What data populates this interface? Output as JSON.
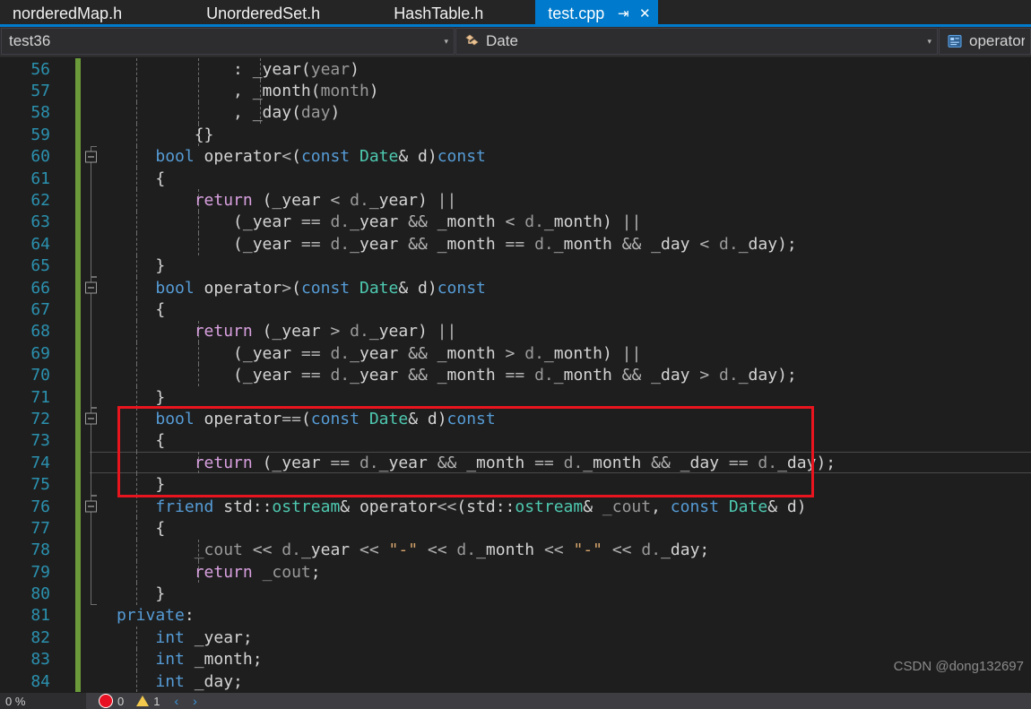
{
  "tabs": [
    {
      "label": "norderedMap.h",
      "active": false
    },
    {
      "label": "UnorderedSet.h",
      "active": false
    },
    {
      "label": "HashTable.h",
      "active": false
    },
    {
      "label": "test.cpp",
      "active": true,
      "pin": "⇥",
      "close": "✕"
    }
  ],
  "navbar": {
    "project": "test36",
    "class": "Date",
    "member": "operator==",
    "arrow": "▾",
    "project_icon": "project-icon",
    "class_icon": "class-icon",
    "member_icon": "method-icon"
  },
  "editor": {
    "lines": [
      {
        "num": "56",
        "indent_guides": [
          0,
          1,
          2
        ],
        "tokens": [
          {
            "t": "            : ",
            "c": "pln"
          },
          {
            "t": "_year",
            "c": "pln"
          },
          {
            "t": "(",
            "c": "pln"
          },
          {
            "t": "year",
            "c": "prm"
          },
          {
            "t": ")",
            "c": "pln"
          }
        ]
      },
      {
        "num": "57",
        "indent_guides": [
          0,
          1,
          2
        ],
        "tokens": [
          {
            "t": "            , ",
            "c": "pln"
          },
          {
            "t": "_month",
            "c": "pln"
          },
          {
            "t": "(",
            "c": "pln"
          },
          {
            "t": "month",
            "c": "prm"
          },
          {
            "t": ")",
            "c": "pln"
          }
        ]
      },
      {
        "num": "58",
        "indent_guides": [
          0,
          1,
          2
        ],
        "tokens": [
          {
            "t": "            , ",
            "c": "pln"
          },
          {
            "t": "_day",
            "c": "pln"
          },
          {
            "t": "(",
            "c": "pln"
          },
          {
            "t": "day",
            "c": "prm"
          },
          {
            "t": ")",
            "c": "pln"
          }
        ]
      },
      {
        "num": "59",
        "indent_guides": [
          0,
          1
        ],
        "tokens": [
          {
            "t": "        {}",
            "c": "pln"
          }
        ]
      },
      {
        "num": "60",
        "indent_guides": [
          0
        ],
        "collapse": true,
        "vline": "top",
        "tokens": [
          {
            "t": "    ",
            "c": "pln"
          },
          {
            "t": "bool",
            "c": "kw"
          },
          {
            "t": " operator",
            "c": "pln"
          },
          {
            "t": "<",
            "c": "op"
          },
          {
            "t": "(",
            "c": "pln"
          },
          {
            "t": "const",
            "c": "kw"
          },
          {
            "t": " ",
            "c": "pln"
          },
          {
            "t": "Date",
            "c": "type"
          },
          {
            "t": "& d)",
            "c": "pln"
          },
          {
            "t": "const",
            "c": "kw"
          }
        ]
      },
      {
        "num": "61",
        "indent_guides": [
          0
        ],
        "vline": "mid",
        "tokens": [
          {
            "t": "    {",
            "c": "pln"
          }
        ]
      },
      {
        "num": "62",
        "indent_guides": [
          0,
          1
        ],
        "vline": "mid",
        "tokens": [
          {
            "t": "        ",
            "c": "pln"
          },
          {
            "t": "return",
            "c": "ctrl"
          },
          {
            "t": " (_year ",
            "c": "pln"
          },
          {
            "t": "<",
            "c": "op"
          },
          {
            "t": " ",
            "c": "pln"
          },
          {
            "t": "d.",
            "c": "prm"
          },
          {
            "t": "_year) ",
            "c": "pln"
          },
          {
            "t": "||",
            "c": "op"
          }
        ]
      },
      {
        "num": "63",
        "indent_guides": [
          0,
          1
        ],
        "vline": "mid",
        "tokens": [
          {
            "t": "            (_year ",
            "c": "pln"
          },
          {
            "t": "==",
            "c": "op"
          },
          {
            "t": " ",
            "c": "pln"
          },
          {
            "t": "d.",
            "c": "prm"
          },
          {
            "t": "_year ",
            "c": "pln"
          },
          {
            "t": "&&",
            "c": "op"
          },
          {
            "t": " _month ",
            "c": "pln"
          },
          {
            "t": "<",
            "c": "op"
          },
          {
            "t": " ",
            "c": "pln"
          },
          {
            "t": "d.",
            "c": "prm"
          },
          {
            "t": "_month) ",
            "c": "pln"
          },
          {
            "t": "||",
            "c": "op"
          }
        ]
      },
      {
        "num": "64",
        "indent_guides": [
          0,
          1
        ],
        "vline": "mid",
        "tokens": [
          {
            "t": "            (_year ",
            "c": "pln"
          },
          {
            "t": "==",
            "c": "op"
          },
          {
            "t": " ",
            "c": "pln"
          },
          {
            "t": "d.",
            "c": "prm"
          },
          {
            "t": "_year ",
            "c": "pln"
          },
          {
            "t": "&&",
            "c": "op"
          },
          {
            "t": " _month ",
            "c": "pln"
          },
          {
            "t": "==",
            "c": "op"
          },
          {
            "t": " ",
            "c": "pln"
          },
          {
            "t": "d.",
            "c": "prm"
          },
          {
            "t": "_month ",
            "c": "pln"
          },
          {
            "t": "&&",
            "c": "op"
          },
          {
            "t": " _day ",
            "c": "pln"
          },
          {
            "t": "<",
            "c": "op"
          },
          {
            "t": " ",
            "c": "pln"
          },
          {
            "t": "d.",
            "c": "prm"
          },
          {
            "t": "_day);",
            "c": "pln"
          }
        ]
      },
      {
        "num": "65",
        "indent_guides": [
          0
        ],
        "vline": "bottom",
        "tokens": [
          {
            "t": "    }",
            "c": "pln"
          }
        ]
      },
      {
        "num": "66",
        "indent_guides": [
          0
        ],
        "collapse": true,
        "vline": "top",
        "tokens": [
          {
            "t": "    ",
            "c": "pln"
          },
          {
            "t": "bool",
            "c": "kw"
          },
          {
            "t": " operator",
            "c": "pln"
          },
          {
            "t": ">",
            "c": "op"
          },
          {
            "t": "(",
            "c": "pln"
          },
          {
            "t": "const",
            "c": "kw"
          },
          {
            "t": " ",
            "c": "pln"
          },
          {
            "t": "Date",
            "c": "type"
          },
          {
            "t": "& d)",
            "c": "pln"
          },
          {
            "t": "const",
            "c": "kw"
          }
        ]
      },
      {
        "num": "67",
        "indent_guides": [
          0
        ],
        "vline": "mid",
        "tokens": [
          {
            "t": "    {",
            "c": "pln"
          }
        ]
      },
      {
        "num": "68",
        "indent_guides": [
          0,
          1
        ],
        "vline": "mid",
        "tokens": [
          {
            "t": "        ",
            "c": "pln"
          },
          {
            "t": "return",
            "c": "ctrl"
          },
          {
            "t": " (_year ",
            "c": "pln"
          },
          {
            "t": ">",
            "c": "op"
          },
          {
            "t": " ",
            "c": "pln"
          },
          {
            "t": "d.",
            "c": "prm"
          },
          {
            "t": "_year) ",
            "c": "pln"
          },
          {
            "t": "||",
            "c": "op"
          }
        ]
      },
      {
        "num": "69",
        "indent_guides": [
          0,
          1
        ],
        "vline": "mid",
        "tokens": [
          {
            "t": "            (_year ",
            "c": "pln"
          },
          {
            "t": "==",
            "c": "op"
          },
          {
            "t": " ",
            "c": "pln"
          },
          {
            "t": "d.",
            "c": "prm"
          },
          {
            "t": "_year ",
            "c": "pln"
          },
          {
            "t": "&&",
            "c": "op"
          },
          {
            "t": " _month ",
            "c": "pln"
          },
          {
            "t": ">",
            "c": "op"
          },
          {
            "t": " ",
            "c": "pln"
          },
          {
            "t": "d.",
            "c": "prm"
          },
          {
            "t": "_month) ",
            "c": "pln"
          },
          {
            "t": "||",
            "c": "op"
          }
        ]
      },
      {
        "num": "70",
        "indent_guides": [
          0,
          1
        ],
        "vline": "mid",
        "tokens": [
          {
            "t": "            (_year ",
            "c": "pln"
          },
          {
            "t": "==",
            "c": "op"
          },
          {
            "t": " ",
            "c": "pln"
          },
          {
            "t": "d.",
            "c": "prm"
          },
          {
            "t": "_year ",
            "c": "pln"
          },
          {
            "t": "&&",
            "c": "op"
          },
          {
            "t": " _month ",
            "c": "pln"
          },
          {
            "t": "==",
            "c": "op"
          },
          {
            "t": " ",
            "c": "pln"
          },
          {
            "t": "d.",
            "c": "prm"
          },
          {
            "t": "_month ",
            "c": "pln"
          },
          {
            "t": "&&",
            "c": "op"
          },
          {
            "t": " _day ",
            "c": "pln"
          },
          {
            "t": ">",
            "c": "op"
          },
          {
            "t": " ",
            "c": "pln"
          },
          {
            "t": "d.",
            "c": "prm"
          },
          {
            "t": "_day);",
            "c": "pln"
          }
        ]
      },
      {
        "num": "71",
        "indent_guides": [
          0
        ],
        "vline": "bottom",
        "tokens": [
          {
            "t": "    }",
            "c": "pln"
          }
        ]
      },
      {
        "num": "72",
        "indent_guides": [
          0
        ],
        "collapse": true,
        "vline": "top",
        "tokens": [
          {
            "t": "    ",
            "c": "pln"
          },
          {
            "t": "bool",
            "c": "kw"
          },
          {
            "t": " operator",
            "c": "pln"
          },
          {
            "t": "==",
            "c": "op"
          },
          {
            "t": "(",
            "c": "pln"
          },
          {
            "t": "const",
            "c": "kw"
          },
          {
            "t": " ",
            "c": "pln"
          },
          {
            "t": "Date",
            "c": "type"
          },
          {
            "t": "& d)",
            "c": "pln"
          },
          {
            "t": "const",
            "c": "kw"
          }
        ]
      },
      {
        "num": "73",
        "indent_guides": [
          0
        ],
        "vline": "mid",
        "tokens": [
          {
            "t": "    {",
            "c": "pln"
          }
        ]
      },
      {
        "num": "74",
        "indent_guides": [
          0,
          1
        ],
        "vline": "mid",
        "current": true,
        "tokens": [
          {
            "t": "        ",
            "c": "pln"
          },
          {
            "t": "return",
            "c": "ctrl"
          },
          {
            "t": " (_year ",
            "c": "pln"
          },
          {
            "t": "==",
            "c": "op"
          },
          {
            "t": " ",
            "c": "pln"
          },
          {
            "t": "d.",
            "c": "prm"
          },
          {
            "t": "_year ",
            "c": "pln"
          },
          {
            "t": "&&",
            "c": "op"
          },
          {
            "t": " _month ",
            "c": "pln"
          },
          {
            "t": "==",
            "c": "op"
          },
          {
            "t": " ",
            "c": "pln"
          },
          {
            "t": "d.",
            "c": "prm"
          },
          {
            "t": "_month ",
            "c": "pln"
          },
          {
            "t": "&&",
            "c": "op"
          },
          {
            "t": " _day ",
            "c": "pln"
          },
          {
            "t": "==",
            "c": "op"
          },
          {
            "t": " ",
            "c": "pln"
          },
          {
            "t": "d.",
            "c": "prm"
          },
          {
            "t": "_day);",
            "c": "pln"
          }
        ]
      },
      {
        "num": "75",
        "indent_guides": [
          0
        ],
        "vline": "bottom",
        "tokens": [
          {
            "t": "    }",
            "c": "pln"
          }
        ]
      },
      {
        "num": "76",
        "indent_guides": [
          0
        ],
        "collapse": true,
        "vline": "top",
        "tokens": [
          {
            "t": "    ",
            "c": "pln"
          },
          {
            "t": "friend",
            "c": "kw"
          },
          {
            "t": " std::",
            "c": "pln"
          },
          {
            "t": "ostream",
            "c": "type"
          },
          {
            "t": "& operator",
            "c": "pln"
          },
          {
            "t": "<<",
            "c": "op"
          },
          {
            "t": "(std::",
            "c": "pln"
          },
          {
            "t": "ostream",
            "c": "type"
          },
          {
            "t": "& ",
            "c": "pln"
          },
          {
            "t": "_cout",
            "c": "prm"
          },
          {
            "t": ", ",
            "c": "pln"
          },
          {
            "t": "const",
            "c": "kw"
          },
          {
            "t": " ",
            "c": "pln"
          },
          {
            "t": "Date",
            "c": "type"
          },
          {
            "t": "& d)",
            "c": "pln"
          }
        ]
      },
      {
        "num": "77",
        "indent_guides": [
          0
        ],
        "vline": "mid",
        "tokens": [
          {
            "t": "    {",
            "c": "pln"
          }
        ]
      },
      {
        "num": "78",
        "indent_guides": [
          0,
          1
        ],
        "vline": "mid",
        "tokens": [
          {
            "t": "        ",
            "c": "pln"
          },
          {
            "t": "_cout",
            "c": "prm"
          },
          {
            "t": " ",
            "c": "pln"
          },
          {
            "t": "<<",
            "c": "op"
          },
          {
            "t": " ",
            "c": "pln"
          },
          {
            "t": "d.",
            "c": "prm"
          },
          {
            "t": "_year ",
            "c": "pln"
          },
          {
            "t": "<<",
            "c": "op"
          },
          {
            "t": " ",
            "c": "pln"
          },
          {
            "t": "\"-\"",
            "c": "str"
          },
          {
            "t": " ",
            "c": "pln"
          },
          {
            "t": "<<",
            "c": "op"
          },
          {
            "t": " ",
            "c": "pln"
          },
          {
            "t": "d.",
            "c": "prm"
          },
          {
            "t": "_month ",
            "c": "pln"
          },
          {
            "t": "<<",
            "c": "op"
          },
          {
            "t": " ",
            "c": "pln"
          },
          {
            "t": "\"-\"",
            "c": "str"
          },
          {
            "t": " ",
            "c": "pln"
          },
          {
            "t": "<<",
            "c": "op"
          },
          {
            "t": " ",
            "c": "pln"
          },
          {
            "t": "d.",
            "c": "prm"
          },
          {
            "t": "_day;",
            "c": "pln"
          }
        ]
      },
      {
        "num": "79",
        "indent_guides": [
          0,
          1
        ],
        "vline": "mid",
        "tokens": [
          {
            "t": "        ",
            "c": "pln"
          },
          {
            "t": "return",
            "c": "ctrl"
          },
          {
            "t": " ",
            "c": "pln"
          },
          {
            "t": "_cout",
            "c": "prm"
          },
          {
            "t": ";",
            "c": "pln"
          }
        ]
      },
      {
        "num": "80",
        "indent_guides": [
          0
        ],
        "vline": "bottom",
        "tokens": [
          {
            "t": "    }",
            "c": "pln"
          }
        ]
      },
      {
        "num": "81",
        "indent_guides": [],
        "tokens": [
          {
            "t": "",
            "c": "pln"
          },
          {
            "t": "private",
            "c": "kw"
          },
          {
            "t": ":",
            "c": "pln"
          }
        ]
      },
      {
        "num": "82",
        "indent_guides": [
          0
        ],
        "tokens": [
          {
            "t": "    ",
            "c": "pln"
          },
          {
            "t": "int",
            "c": "kw"
          },
          {
            "t": " _year;",
            "c": "pln"
          }
        ]
      },
      {
        "num": "83",
        "indent_guides": [
          0
        ],
        "tokens": [
          {
            "t": "    ",
            "c": "pln"
          },
          {
            "t": "int",
            "c": "kw"
          },
          {
            "t": " _month;",
            "c": "pln"
          }
        ]
      },
      {
        "num": "84",
        "indent_guides": [
          0
        ],
        "tokens": [
          {
            "t": "    ",
            "c": "pln"
          },
          {
            "t": "int",
            "c": "kw"
          },
          {
            "t": " _day;",
            "c": "pln"
          }
        ]
      }
    ],
    "annotation": {
      "color": "#e8141e"
    }
  },
  "watermark": "CSDN @dong132697",
  "statusbar": {
    "zoom": "0 %",
    "errors": "0",
    "warnings": "1"
  },
  "colors": {
    "accent": "#007acc",
    "keyword": "#569cd6",
    "type": "#4ec9b0",
    "control": "#d8a0df",
    "string": "#d6a46c",
    "linenum": "#2b91af",
    "changebar": "#6a9a3a",
    "annotation": "#e8141e",
    "editor_bg": "#1e1e1e"
  }
}
